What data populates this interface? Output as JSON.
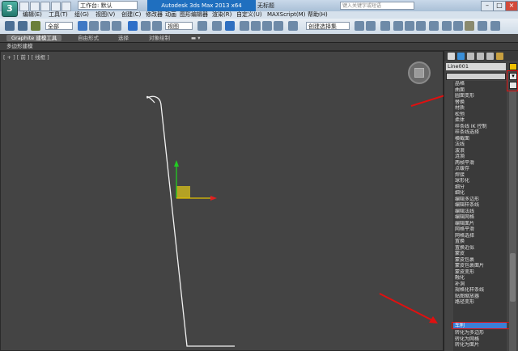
{
  "title_bar": {
    "workspace_label": "工作台: 默认",
    "app_title": "Autodesk 3ds Max  2013 x64",
    "doc_title": "无标题",
    "search_placeholder": "键入关键字或短语",
    "window_buttons": [
      "–",
      "□",
      "×"
    ]
  },
  "menus": [
    "编辑(E)",
    "工具(T)",
    "组(G)",
    "视图(V)",
    "创建(C)",
    "修改器",
    "动画",
    "图形编辑器",
    "渲染(R)",
    "自定义(U)",
    "MAXScript(M)",
    "帮助(H)"
  ],
  "toolbar": {
    "selection_filter": "全部",
    "view_select": "视图",
    "named_set": "创建选择集"
  },
  "ribbon": {
    "tabs": [
      "Graphite 建模工具",
      "自由形式",
      "选择",
      "对象绘制"
    ],
    "sub_label": "多边形建模"
  },
  "viewport": {
    "label": "[ + ] [ 前 ] [ 线框 ]"
  },
  "command_panel": {
    "object_name": "Line001",
    "modifier_list": [
      "晶格",
      "曲面",
      "圆面变形",
      "替换",
      "材质",
      "松弛",
      "柔体",
      "样条线 IK 控制",
      "样条线选择",
      "横截面",
      "法线",
      "波浪",
      "涟漪",
      "两帧平滑",
      "点缓存",
      "焊接",
      "球形化",
      "细分",
      "细化",
      "编辑多边形",
      "编辑样条线",
      "编辑法线",
      "编辑网格",
      "编辑面片",
      "网格平滑",
      "网格选择",
      "置换",
      "置换近似",
      "蒙皮",
      "蒙皮包裹",
      "蒙皮包裹面片",
      "蒙皮变形",
      "融化",
      "补洞",
      "规格化样条线",
      "贴图缩放器",
      "路径变形",
      "车削",
      "转化为多边形",
      "转化为网格",
      "转化为面片"
    ],
    "selected_item": "车削"
  },
  "colors": {
    "annotation": "#e01010",
    "selection": "#3d7fd6",
    "object_color": "#f0c000"
  }
}
